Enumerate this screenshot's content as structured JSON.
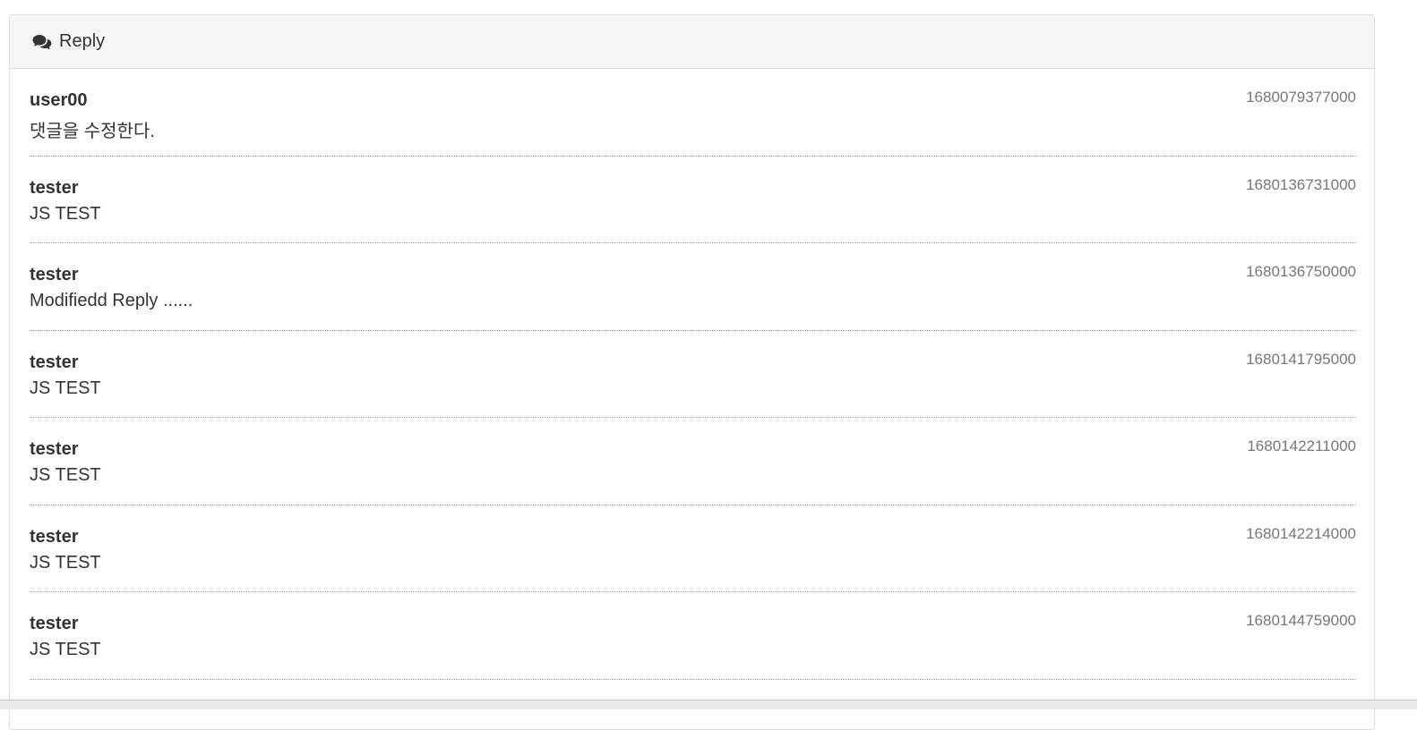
{
  "panel": {
    "title": "Reply",
    "icon": "comments-icon"
  },
  "replies": [
    {
      "replyer": "user00",
      "reply": "댓글을 수정한다.",
      "replyDate": "1680079377000"
    },
    {
      "replyer": "tester",
      "reply": "JS TEST",
      "replyDate": "1680136731000"
    },
    {
      "replyer": "tester",
      "reply": "Modifiedd Reply ......",
      "replyDate": "1680136750000"
    },
    {
      "replyer": "tester",
      "reply": "JS TEST",
      "replyDate": "1680141795000"
    },
    {
      "replyer": "tester",
      "reply": "JS TEST",
      "replyDate": "1680142211000"
    },
    {
      "replyer": "tester",
      "reply": "JS TEST",
      "replyDate": "1680142214000"
    },
    {
      "replyer": "tester",
      "reply": "JS TEST",
      "replyDate": "1680144759000"
    }
  ],
  "colors": {
    "heading_bg": "#f5f5f5",
    "border": "#dddddd",
    "text": "#333333",
    "muted": "#777777"
  }
}
